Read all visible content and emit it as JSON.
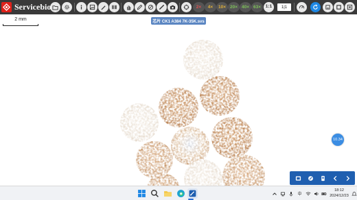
{
  "brand": {
    "name": "Servicebio",
    "logo_icon": "servicebio-logo-icon"
  },
  "toolbar": {
    "zoom_levels": [
      "2×",
      "4×",
      "10×",
      "20×",
      "40×",
      "63×"
    ],
    "one_to_one": "1:1",
    "scale_select_value": "1|1",
    "zoom_colors": [
      "#e05252",
      "#e3b33b",
      "#e3b33b",
      "#7fc25a",
      "#7fc25a",
      "#7fc25a"
    ]
  },
  "viewer": {
    "scale_label": "2 mm",
    "slide_title": "芯片 CK1 A384 7K-35K.svs",
    "badge": "10.34"
  },
  "taskbar": {
    "time": "18:12",
    "date": "2024/12/23",
    "ime": "中"
  },
  "colors": {
    "toolbar_bg": "#3a3a3a",
    "brand_red": "#e0211a",
    "accent_blue": "#1e88e5",
    "nav_panel": "#1f5fb0",
    "stain_strong": "#b86a28",
    "stain_weak": "#e8ddd0"
  }
}
